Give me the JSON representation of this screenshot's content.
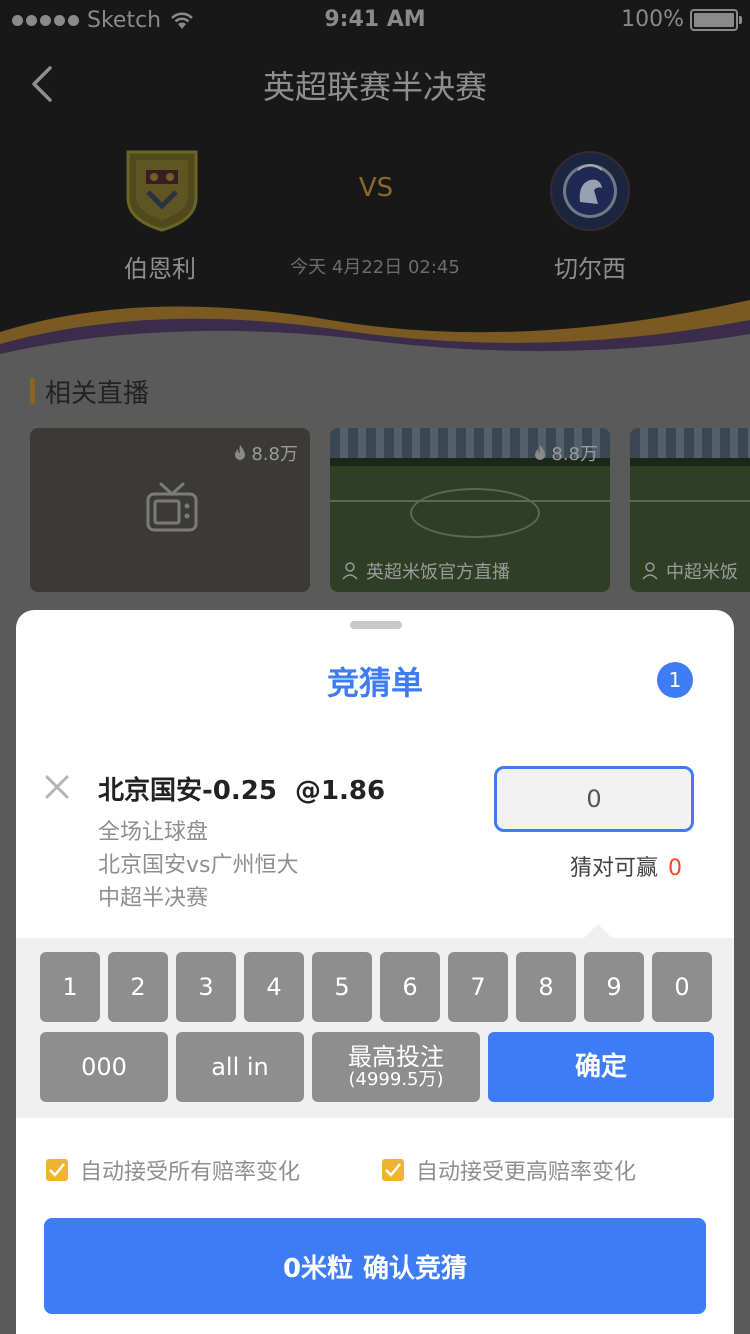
{
  "status_bar": {
    "carrier": "Sketch",
    "time": "9:41 AM",
    "battery": "100%"
  },
  "header": {
    "title": "英超联赛半决赛",
    "home_team": "伯恩利",
    "away_team": "切尔西",
    "vs": "VS",
    "match_time": "今天 4月22日 02:45"
  },
  "live_section": {
    "title": "相关直播",
    "cards": [
      {
        "heat": "8.8万",
        "label": ""
      },
      {
        "heat": "8.8万",
        "label": "英超米饭官方直播"
      },
      {
        "heat": "",
        "label": "中超米饭"
      }
    ]
  },
  "bet_slip": {
    "title": "竞猜单",
    "count": "1",
    "selection": "北京国安-0.25",
    "odds": "@1.86",
    "market": "全场让球盘",
    "match": "北京国安vs广州恒大",
    "competition": "中超半决赛",
    "stake_value": "0",
    "win_label": "猜对可赢",
    "win_value": "0",
    "keys": [
      "1",
      "2",
      "3",
      "4",
      "5",
      "6",
      "7",
      "8",
      "9",
      "0"
    ],
    "key_000": "000",
    "key_allin": "all in",
    "key_max_label": "最高投注",
    "key_max_value": "(4999.5万)",
    "key_confirm": "确定",
    "accept_all_label": "自动接受所有赔率变化",
    "accept_higher_label": "自动接受更高赔率变化",
    "submit_amount": "0米粒",
    "submit_label": "确认竞猜"
  },
  "colors": {
    "accent": "#3d7cf4",
    "highlight": "#f24a24",
    "checkbox": "#f0b232",
    "gold": "#8a6420"
  },
  "icons": [
    "back-icon",
    "wifi-icon",
    "burnley-crest-icon",
    "chelsea-crest-icon",
    "fire-icon",
    "tv-icon",
    "user-icon",
    "close-icon",
    "check-icon"
  ]
}
